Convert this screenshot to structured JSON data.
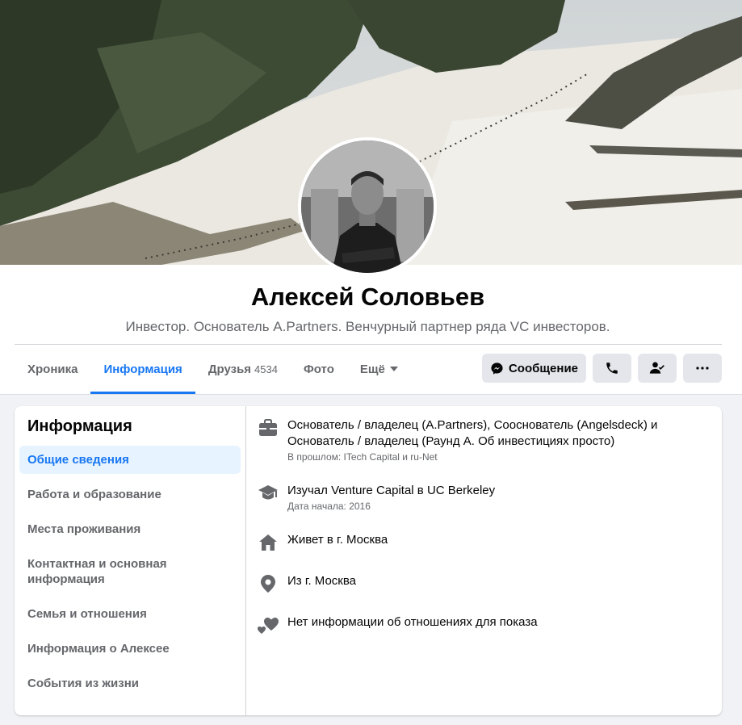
{
  "profile": {
    "name": "Алексей Соловьев",
    "bio": "Инвестор. Основатель A.Partners. Венчурный партнер ряда VC инвесторов."
  },
  "tabs": [
    {
      "label": "Хроника"
    },
    {
      "label": "Информация",
      "active": true
    },
    {
      "label": "Друзья",
      "count": "4534"
    },
    {
      "label": "Фото"
    },
    {
      "label": "Ещё"
    }
  ],
  "actions": {
    "message_label": "Сообщение"
  },
  "sidebar": {
    "title": "Информация",
    "items": [
      {
        "label": "Общие сведения",
        "active": true
      },
      {
        "label": "Работа и образование"
      },
      {
        "label": "Места проживания"
      },
      {
        "label": "Контактная и основная информация"
      },
      {
        "label": "Семья и отношения"
      },
      {
        "label": "Информация о Алексее"
      },
      {
        "label": "События из жизни"
      }
    ]
  },
  "overview": {
    "work": {
      "text": "Основатель / владелец (A.Partners), Сооснователь (Angelsdeck) и Основатель / владелец (Раунд А. Об инвестициях просто)",
      "sub": "В прошлом: ITech Capital и ru-Net",
      "icon": "briefcase-icon"
    },
    "education": {
      "text": "Изучал Venture Capital в UC Berkeley",
      "sub": "Дата начала: 2016",
      "icon": "graduation-cap-icon"
    },
    "lives": {
      "text": "Живет в г. Москва",
      "icon": "home-icon"
    },
    "from": {
      "text": "Из г. Москва",
      "icon": "location-pin-icon"
    },
    "relationship": {
      "text": "Нет информации об отношениях для показа",
      "icon": "hearts-icon"
    }
  },
  "colors": {
    "accent": "#1877f2",
    "secondary_text": "#65676b",
    "button_bg": "#e4e6eb",
    "page_bg": "#f0f2f5"
  }
}
